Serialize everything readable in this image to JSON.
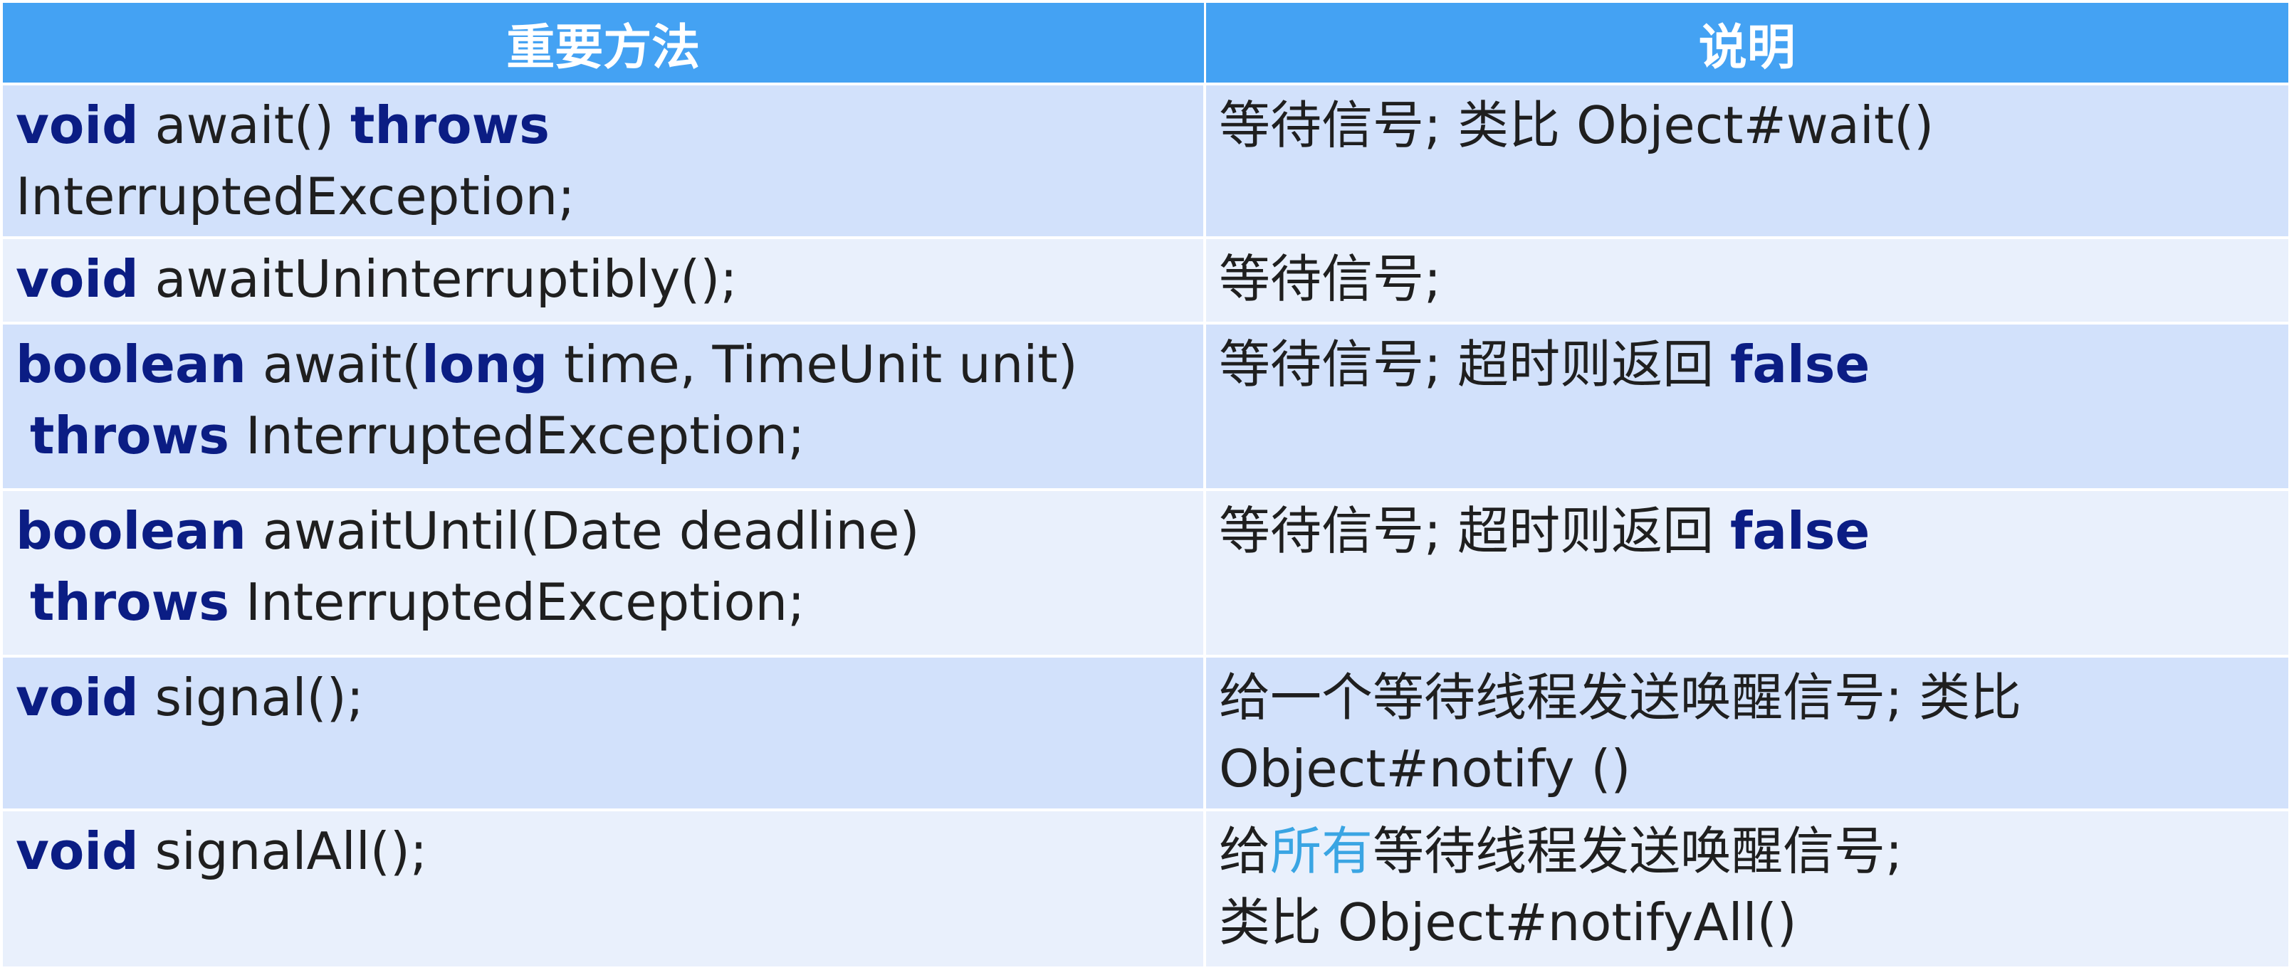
{
  "header": {
    "col_method": "重要方法",
    "col_desc": "说明"
  },
  "rows": [
    {
      "method_lines": [
        [
          {
            "t": "void",
            "kw": true
          },
          {
            "t": " await() "
          },
          {
            "t": "throws",
            "kw": true
          }
        ],
        [
          {
            "t": "InterruptedException;"
          }
        ]
      ],
      "desc_lines": [
        [
          {
            "t": "等待信号; 类比 Object#wait()"
          }
        ]
      ]
    },
    {
      "method_lines": [
        [
          {
            "t": "void",
            "kw": true
          },
          {
            "t": " awaitUninterruptibly();"
          }
        ]
      ],
      "desc_lines": [
        [
          {
            "t": "等待信号;"
          }
        ]
      ]
    },
    {
      "method_lines": [
        [
          {
            "t": "boolean",
            "kw": true
          },
          {
            "t": " await("
          },
          {
            "t": "long",
            "kw": true
          },
          {
            "t": " time, TimeUnit unit)"
          }
        ],
        [
          {
            "t": "throws",
            "kw": true
          },
          {
            "t": " InterruptedException;"
          }
        ]
      ],
      "desc_lines": [
        [
          {
            "t": "等待信号; 超时则返回 "
          },
          {
            "t": "false",
            "kw": true
          }
        ]
      ]
    },
    {
      "method_lines": [
        [
          {
            "t": "boolean",
            "kw": true
          },
          {
            "t": " awaitUntil(Date deadline)"
          }
        ],
        [
          {
            "t": "throws",
            "kw": true
          },
          {
            "t": " InterruptedException;"
          }
        ]
      ],
      "desc_lines": [
        [
          {
            "t": "等待信号; 超时则返回 "
          },
          {
            "t": "false",
            "kw": true
          }
        ]
      ]
    },
    {
      "method_lines": [
        [
          {
            "t": "void",
            "kw": true
          },
          {
            "t": " signal();"
          }
        ]
      ],
      "desc_lines": [
        [
          {
            "t": "给一个等待线程发送唤醒信号; 类比"
          }
        ],
        [
          {
            "t": "Object#notify ()"
          }
        ]
      ]
    },
    {
      "method_lines": [
        [
          {
            "t": "void",
            "kw": true
          },
          {
            "t": " signalAll();"
          }
        ]
      ],
      "desc_lines": [
        [
          {
            "t": "给"
          },
          {
            "t": "所有",
            "accent": true
          },
          {
            "t": "等待线程发送唤醒信号;"
          }
        ],
        [
          {
            "t": "类比 Object#notifyAll()"
          }
        ]
      ]
    }
  ],
  "colors": {
    "header_bg": "#44a2f3",
    "header_text": "#ffffff",
    "row_dark": "#d2e1fb",
    "row_light": "#e9f0fc",
    "keyword": "#0b1d84",
    "accent": "#3aa5e3",
    "text": "#1f1f1f"
  }
}
